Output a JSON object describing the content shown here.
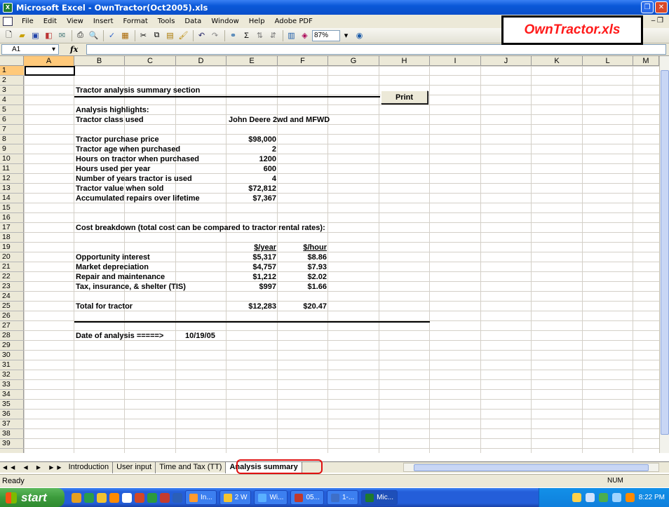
{
  "window": {
    "title": "Microsoft Excel - OwnTractor(Oct2005).xls"
  },
  "callout": "OwnTractor.xls",
  "menu": [
    "File",
    "Edit",
    "View",
    "Insert",
    "Format",
    "Tools",
    "Data",
    "Window",
    "Help",
    "Adobe PDF"
  ],
  "toolbar": {
    "zoom": "87%"
  },
  "formula_bar": {
    "name_box": "A1",
    "fx": "fx",
    "value": ""
  },
  "columns": [
    "A",
    "B",
    "C",
    "D",
    "E",
    "F",
    "G",
    "H",
    "I",
    "J",
    "K",
    "L",
    "M"
  ],
  "rows": [
    "1",
    "2",
    "3",
    "4",
    "5",
    "6",
    "7",
    "8",
    "9",
    "10",
    "11",
    "12",
    "13",
    "14",
    "15",
    "16",
    "17",
    "18",
    "19",
    "20",
    "21",
    "22",
    "23",
    "24",
    "25",
    "26",
    "27",
    "28",
    "29",
    "30",
    "31",
    "32",
    "33",
    "34",
    "35",
    "36",
    "37",
    "38",
    "39"
  ],
  "sheet": {
    "title": "Tractor analysis summary section",
    "print_label": "Print",
    "highlights_heading": "Analysis highlights:",
    "tractor_class_label": "Tractor class used",
    "tractor_class_value": "John Deere 2wd and MFWD",
    "params": [
      {
        "label": "Tractor purchase price",
        "value": "$98,000"
      },
      {
        "label": "Tractor age when purchased",
        "value": "2"
      },
      {
        "label": "Hours on tractor when purchased",
        "value": "1200"
      },
      {
        "label": "Hours used per year",
        "value": "600"
      },
      {
        "label": "Number of years tractor is used",
        "value": "4"
      },
      {
        "label": "Tractor value when sold",
        "value": "$72,812"
      },
      {
        "label": "Accumulated repairs over lifetime",
        "value": "$7,367"
      }
    ],
    "cost_heading": "Cost breakdown (total cost can be compared to tractor rental rates):",
    "cost_col_year": "$/year",
    "cost_col_hour": "$/hour",
    "costs": [
      {
        "label": "Opportunity interest",
        "year": "$5,317",
        "hour": "$8.86"
      },
      {
        "label": "Market depreciation",
        "year": "$4,757",
        "hour": "$7.93"
      },
      {
        "label": "Repair and maintenance",
        "year": "$1,212",
        "hour": "$2.02"
      },
      {
        "label": "Tax, insurance, & shelter (TIS)",
        "year": "$997",
        "hour": "$1.66"
      }
    ],
    "total": {
      "label": "Total for tractor",
      "year": "$12,283",
      "hour": "$20.47"
    },
    "date_label": "Date of analysis =====>",
    "date_value": "10/19/05"
  },
  "tabs": [
    "Introduction",
    "User input",
    "Time and Tax (TT)",
    "Analysis summary"
  ],
  "active_tab": "Analysis summary",
  "status": {
    "left": "Ready",
    "num": "NUM"
  },
  "taskbar": {
    "start": "start",
    "tasks": [
      "In...",
      "2 W",
      "Wi...",
      "05...",
      "1-...",
      "Mic..."
    ],
    "clock": "8:22 PM"
  }
}
